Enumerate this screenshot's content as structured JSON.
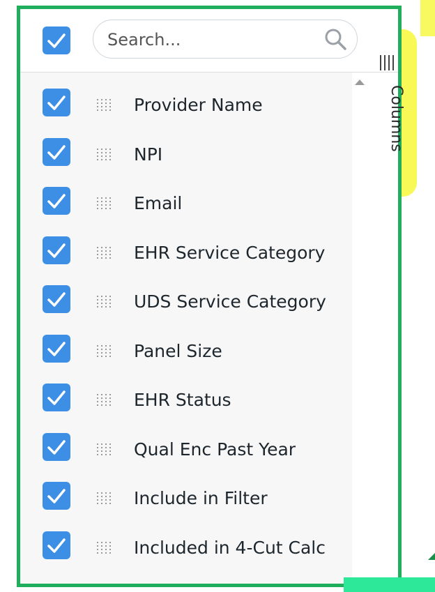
{
  "search": {
    "placeholder": "Search..."
  },
  "side_tab": {
    "label": "Columns"
  },
  "columns": [
    {
      "label": "Provider Name",
      "checked": true
    },
    {
      "label": "NPI",
      "checked": true
    },
    {
      "label": "Email",
      "checked": true
    },
    {
      "label": "EHR Service Category",
      "checked": true
    },
    {
      "label": "UDS Service Category",
      "checked": true
    },
    {
      "label": "Panel Size",
      "checked": true
    },
    {
      "label": "EHR Status",
      "checked": true
    },
    {
      "label": "Qual Enc Past Year",
      "checked": true
    },
    {
      "label": "Include in Filter",
      "checked": true
    },
    {
      "label": "Included in 4-Cut Calc",
      "checked": true
    }
  ],
  "colors": {
    "checkbox": "#3d8fe6",
    "panel_border": "#1fae5b",
    "tab_highlight": "#f5f51e"
  }
}
